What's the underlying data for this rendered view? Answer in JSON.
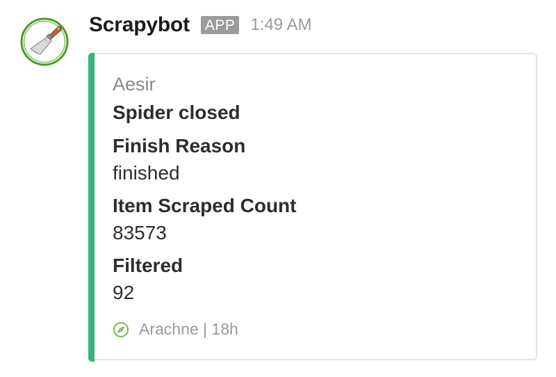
{
  "message": {
    "sender": "Scrapybot",
    "badge": "APP",
    "time": "1:49 AM",
    "avatar_icon": "spatula-icon"
  },
  "attachment": {
    "accent_color": "#36b37e",
    "author": "Aesir",
    "title": "Spider closed",
    "fields": [
      {
        "title": "Finish Reason",
        "value": "finished"
      },
      {
        "title": "Item Scraped Count",
        "value": "83573"
      },
      {
        "title": "Filtered",
        "value": "92"
      }
    ],
    "footer": {
      "icon": "compass-icon",
      "text": "Arachne | 18h"
    }
  }
}
